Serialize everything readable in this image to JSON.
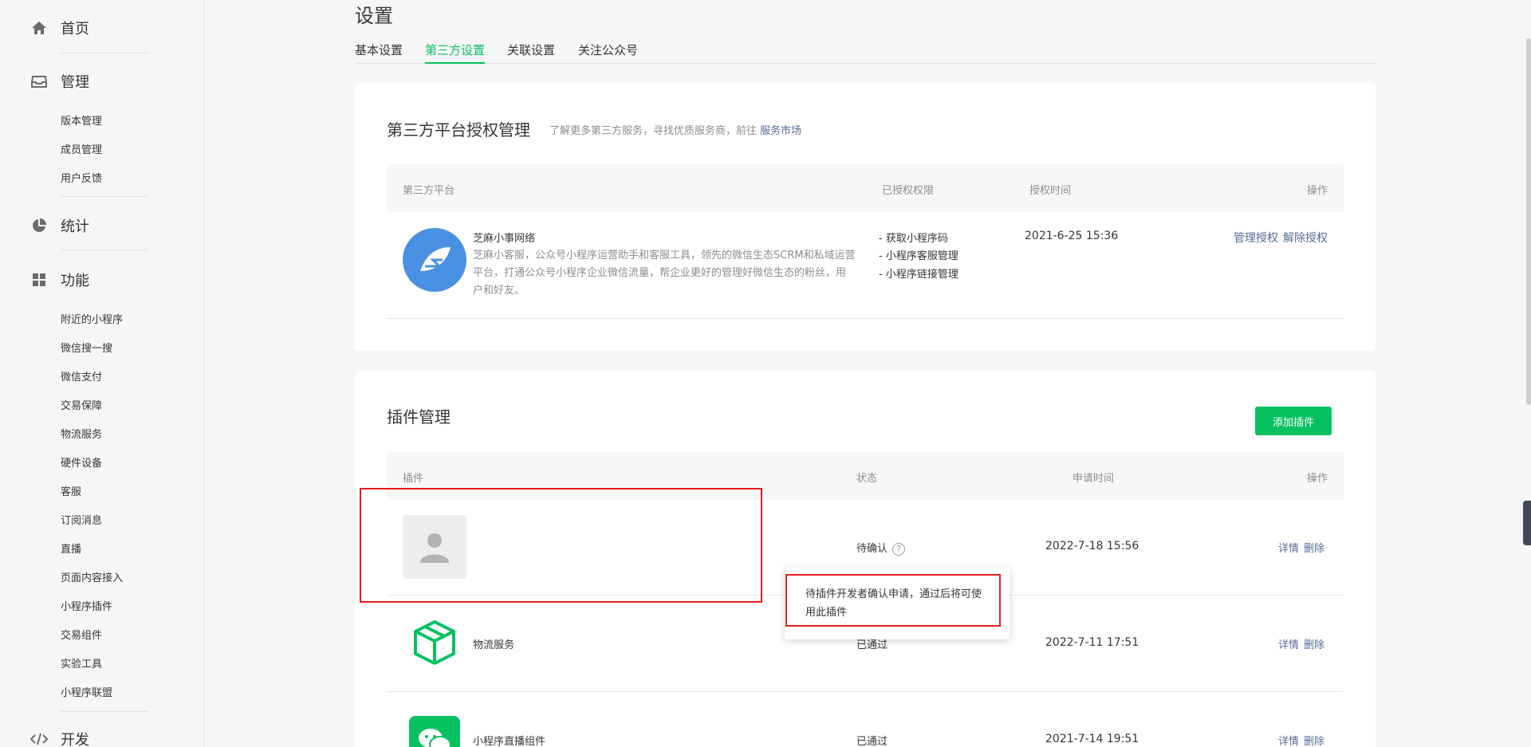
{
  "sidebar": {
    "home": "首页",
    "manage": "管理",
    "manage_items": [
      "版本管理",
      "成员管理",
      "用户反馈"
    ],
    "stats": "统计",
    "features": "功能",
    "feature_items": [
      "附近的小程序",
      "微信搜一搜",
      "微信支付",
      "交易保障",
      "物流服务",
      "硬件设备",
      "客服",
      "订阅消息",
      "直播",
      "页面内容接入",
      "小程序插件",
      "交易组件",
      "实验工具",
      "小程序联盟"
    ],
    "dev": "开发"
  },
  "page": {
    "title": "设置",
    "tabs": [
      "基本设置",
      "第三方设置",
      "关联设置",
      "关注公众号"
    ]
  },
  "third_party": {
    "title": "第三方平台授权管理",
    "hint_prefix": "了解更多第三方服务，寻找优质服务商，前往",
    "hint_link": "服务市场",
    "headers": [
      "第三方平台",
      "已授权权限",
      "授权时间",
      "操作"
    ],
    "row": {
      "name": "芝麻小事网络",
      "desc": "芝麻小客服，公众号小程序运营助手和客服工具，领先的微信生态SCRM和私域运营平台，打通公众号小程序企业微信流量，帮企业更好的管理好微信生态的粉丝，用户和好友。",
      "permissions": [
        "- 获取小程序码",
        "- 小程序客服管理",
        "- 小程序链接管理"
      ],
      "time": "2021-6-25 15:36",
      "actions": [
        "管理授权",
        "解除授权"
      ]
    }
  },
  "plugins": {
    "title": "插件管理",
    "add_button": "添加插件",
    "headers": [
      "插件",
      "状态",
      "申请时间",
      "操作"
    ],
    "rows": [
      {
        "name": "",
        "status": "待确认",
        "time": "2022-7-18 15:56",
        "actions": [
          "详情",
          "删除"
        ]
      },
      {
        "name": "物流服务",
        "status": "已通过",
        "time": "2022-7-11 17:51",
        "actions": [
          "详情",
          "删除"
        ]
      },
      {
        "name": "小程序直播组件",
        "status": "已通过",
        "time": "2021-7-14 19:51",
        "actions": [
          "详情",
          "删除"
        ]
      }
    ],
    "tooltip": "待插件开发者确认申请，通过后将可使用此插件"
  },
  "colors": {
    "accent": "#07c160",
    "link": "#576b95",
    "highlight": "#e41d1d"
  }
}
